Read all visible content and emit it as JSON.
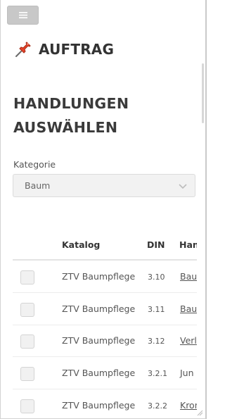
{
  "header": {
    "menu_icon": "hamburger-icon",
    "brand_icon": "pushpin-icon",
    "brand_title": "AUFTRAG"
  },
  "main": {
    "heading_line1": "HANDLUNGEN",
    "heading_line2": "AUSWÄHLEN",
    "category": {
      "label": "Kategorie",
      "selected": "Baum",
      "icon": "chevron-down-icon"
    },
    "table": {
      "columns": [
        "",
        "Katalog",
        "DIN",
        "Han"
      ],
      "rows": [
        {
          "katalog": "ZTV Baumpflege",
          "din": "3.10",
          "handlung": "Bau"
        },
        {
          "katalog": "ZTV Baumpflege",
          "din": "3.11",
          "handlung": "Bau"
        },
        {
          "katalog": "ZTV Baumpflege",
          "din": "3.12",
          "handlung": "Verl"
        },
        {
          "katalog": "ZTV Baumpflege",
          "din": "3.2.1",
          "handlung": "Jun"
        },
        {
          "katalog": "ZTV Baumpflege",
          "din": "3.2.2",
          "handlung": "Kron"
        }
      ]
    }
  },
  "colors": {
    "accent_pin": "#e8442b",
    "menu_button": "#c8c8c8"
  }
}
